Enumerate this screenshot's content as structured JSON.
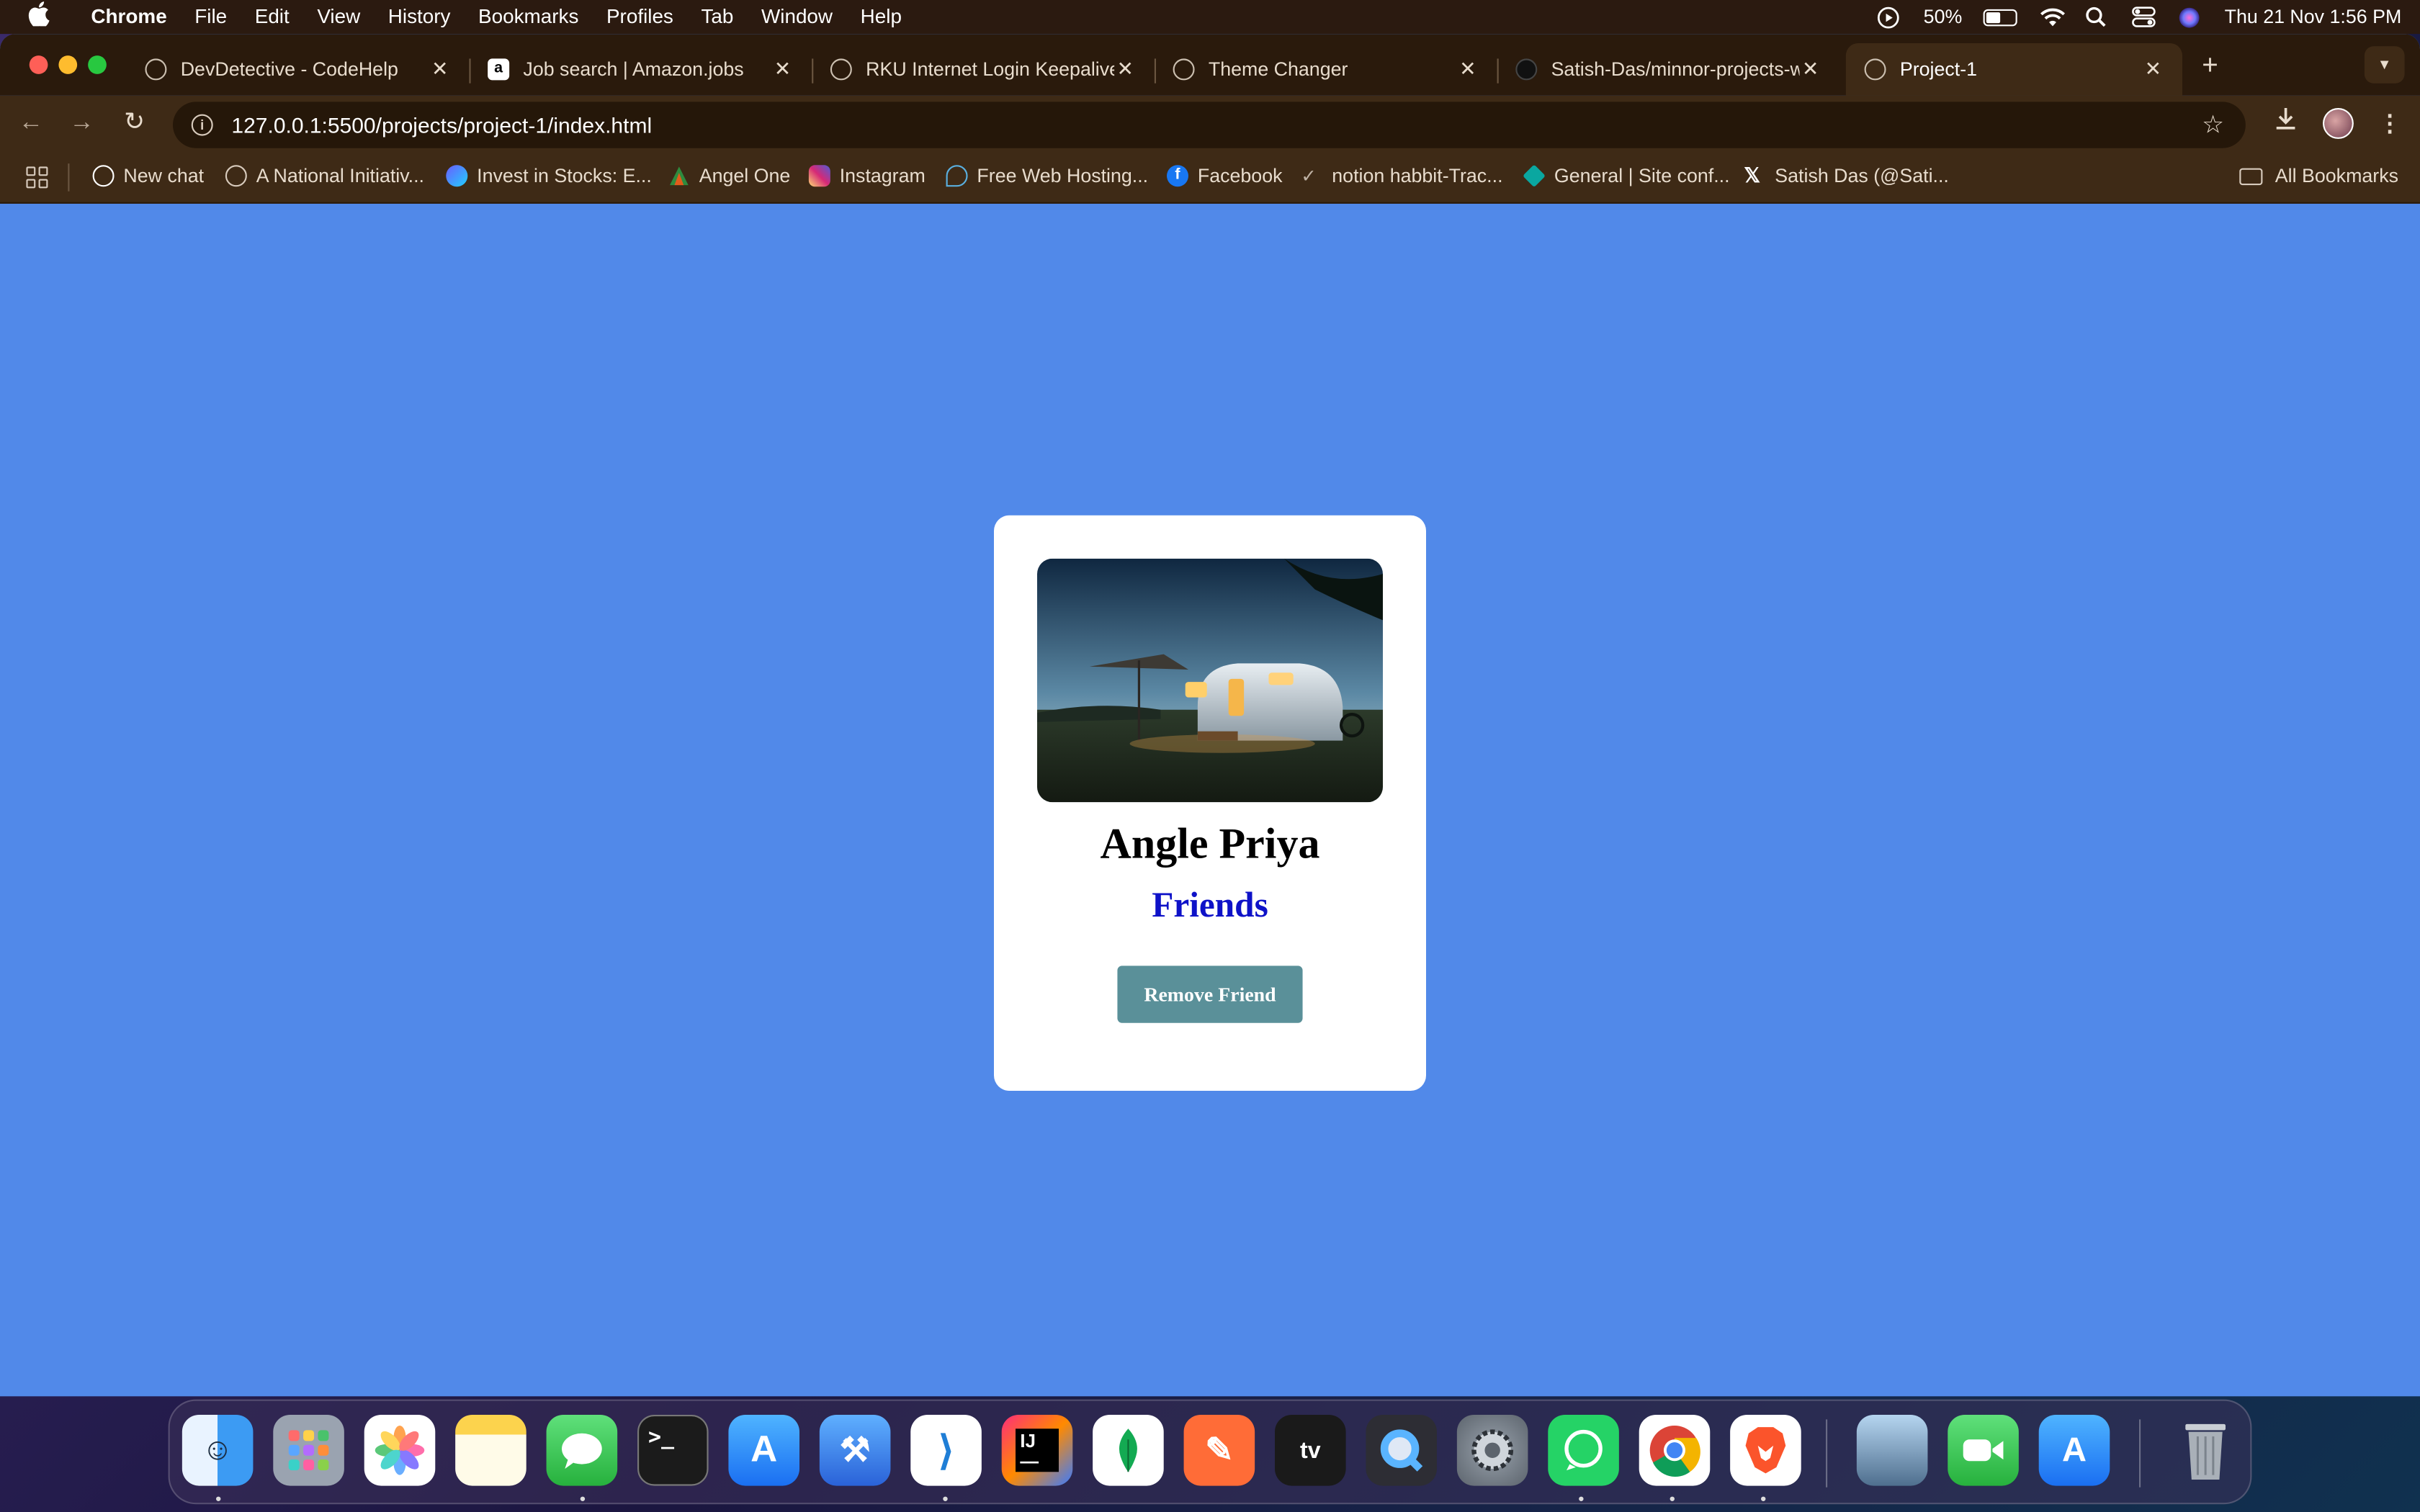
{
  "menubar": {
    "app_name": "Chrome",
    "items": [
      "File",
      "Edit",
      "View",
      "History",
      "Bookmarks",
      "Profiles",
      "Tab",
      "Window",
      "Help"
    ],
    "battery": "50%",
    "datetime": "Thu 21 Nov  1:56 PM"
  },
  "tabs": [
    {
      "title": "DevDetective - CodeHelp",
      "icon": "globe-icon"
    },
    {
      "title": "Job search | Amazon.jobs",
      "icon": "amazon-icon"
    },
    {
      "title": "RKU Internet Login Keepalive",
      "icon": "globe-icon"
    },
    {
      "title": "Theme Changer",
      "icon": "globe-icon"
    },
    {
      "title": "Satish-Das/minnor-projects-w",
      "icon": "github-icon"
    },
    {
      "title": "Project-1",
      "icon": "globe-icon",
      "active": true
    }
  ],
  "toolbar": {
    "url": "127.0.0.1:5500/projects/project-1/index.html"
  },
  "bookmarks": [
    {
      "label": "New chat",
      "icon": "chatgpt-icon"
    },
    {
      "label": "A National Initiativ...",
      "icon": "globe-icon"
    },
    {
      "label": "Invest in Stocks: E...",
      "icon": "invest-icon"
    },
    {
      "label": "Angel One",
      "icon": "angel-one-icon"
    },
    {
      "label": "Instagram",
      "icon": "instagram-icon"
    },
    {
      "label": "Free Web Hosting...",
      "icon": "hosting-icon"
    },
    {
      "label": "Facebook",
      "icon": "facebook-icon"
    },
    {
      "label": "notion habbit-Trac...",
      "icon": "check-icon"
    },
    {
      "label": "General | Site conf...",
      "icon": "netlify-icon"
    },
    {
      "label": "Satish Das (@Sati...",
      "icon": "x-icon"
    }
  ],
  "all_bookmarks_label": "All Bookmarks",
  "card": {
    "name": "Angle Priya",
    "status": "Friends",
    "button_label": "Remove Friend"
  },
  "dock": {
    "apps": [
      "Finder",
      "Launchpad",
      "Photos",
      "Notes",
      "Messages",
      "Terminal",
      "App Store",
      "Xcode",
      "Visual Studio Code",
      "IntelliJ IDEA",
      "MongoDB Compass",
      "Postman",
      "Apple TV",
      "QuickTime Player",
      "System Settings",
      "WhatsApp",
      "Google Chrome",
      "Brave Browser",
      "Preview",
      "FaceTime",
      "Simulator",
      "Trash"
    ]
  },
  "colors": {
    "page_background": "#5189e9",
    "status_text": "#0e12c8",
    "button_bg": "#5a9099",
    "chrome_frame": "#3e2a16"
  }
}
